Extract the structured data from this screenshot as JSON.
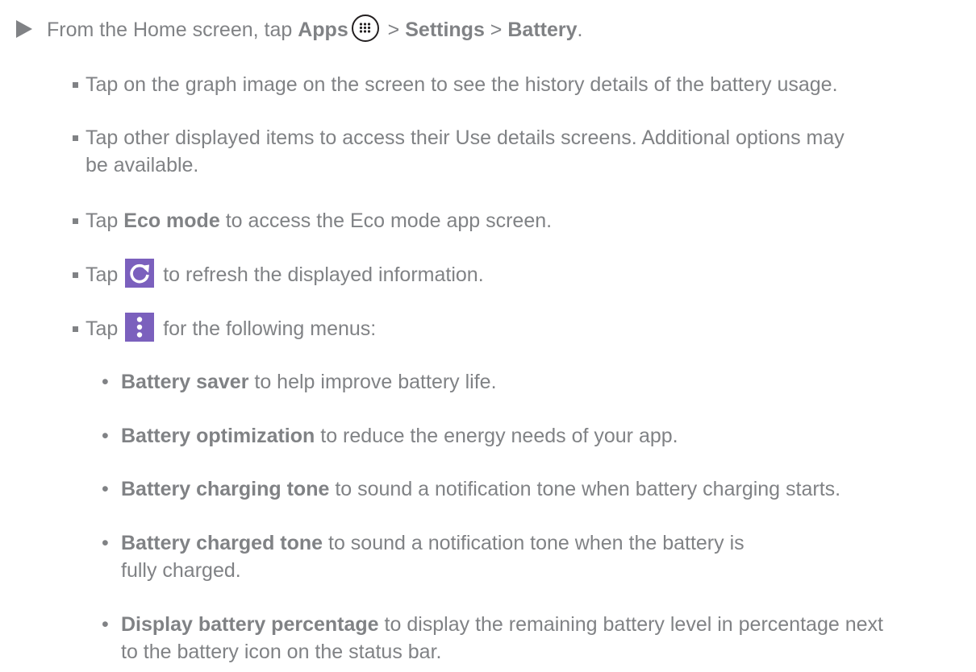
{
  "step": {
    "prefix": "From the Home screen, tap ",
    "apps_label": "Apps",
    "sep1": " > ",
    "settings_label": "Settings",
    "sep2": " > ",
    "battery_label": "Battery",
    "suffix": "."
  },
  "bullets": [
    {
      "text": "Tap on the graph image on the screen to see the history details of the battery usage."
    },
    {
      "text": "Tap other displayed items to access their Use details screens. Additional options may be available."
    },
    {
      "pre": "Tap ",
      "bold": "Eco mode",
      "post": " to access the Eco mode app screen."
    },
    {
      "pre": "Tap ",
      "post": " to refresh the displayed information.",
      "icon": "refresh-icon"
    },
    {
      "pre": "Tap ",
      "post": " for the following menus:",
      "icon": "more-options-icon"
    }
  ],
  "menus": [
    {
      "bold": "Battery saver",
      "text": " to help improve battery life."
    },
    {
      "bold": "Battery optimization",
      "text": " to reduce the energy needs of your app."
    },
    {
      "bold": "Battery charging tone",
      "text": " to sound a notification tone when battery charging starts."
    },
    {
      "bold": "Battery charged tone",
      "text": " to sound a notification tone when the battery is fully charged."
    },
    {
      "bold": "Display battery percentage",
      "text": " to display the remaining battery level in percentage next to the battery icon on the status bar."
    }
  ],
  "colors": {
    "text": "#808285",
    "icon_bg": "#7b60bd"
  }
}
